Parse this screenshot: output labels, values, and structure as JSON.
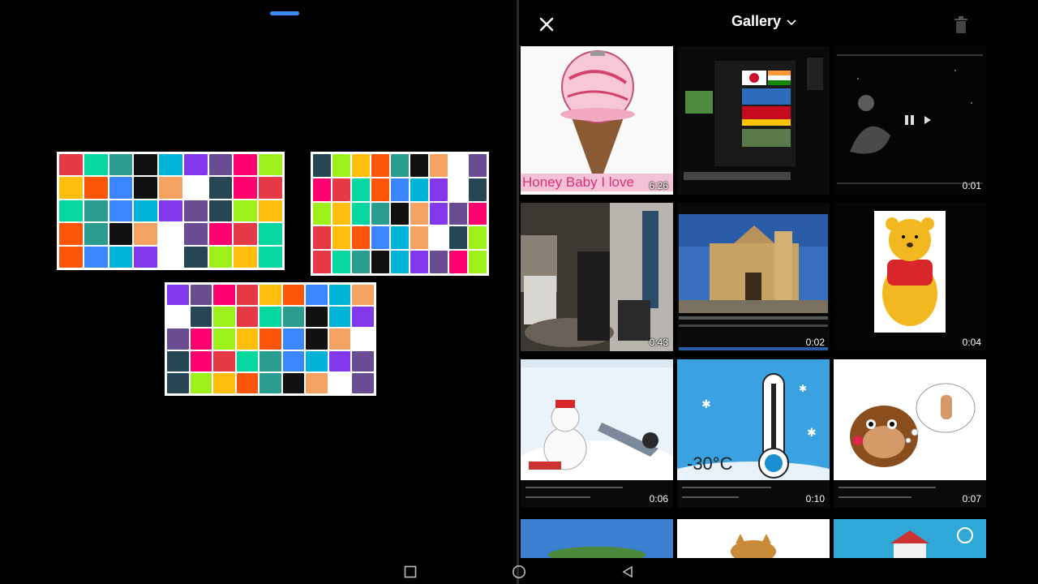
{
  "left_pane": {
    "collages": [
      {
        "name": "collage-preview-1"
      },
      {
        "name": "collage-preview-2"
      },
      {
        "name": "collage-preview-3"
      }
    ]
  },
  "gallery": {
    "title": "Gallery",
    "close_icon": "close-icon",
    "dropdown_icon": "chevron-down-icon",
    "trash_icon": "trash-icon",
    "items": [
      {
        "name": "gallery-item-ice-cream",
        "duration": "6:26",
        "overlay_text": "Honey Baby I love"
      },
      {
        "name": "gallery-item-flags-video",
        "duration": ""
      },
      {
        "name": "gallery-item-fairy-night",
        "duration": "0:01"
      },
      {
        "name": "gallery-item-room",
        "duration": "0:43"
      },
      {
        "name": "gallery-item-church",
        "duration": "0:02"
      },
      {
        "name": "gallery-item-pooh",
        "duration": "0:04"
      },
      {
        "name": "gallery-item-snowman",
        "duration": "0:06"
      },
      {
        "name": "gallery-item-thermometer",
        "duration": "0:10",
        "overlay_text": "-30°C"
      },
      {
        "name": "gallery-item-beaver",
        "duration": "0:07"
      },
      {
        "name": "gallery-item-sky",
        "duration": ""
      },
      {
        "name": "gallery-item-cat",
        "duration": ""
      },
      {
        "name": "gallery-item-doghouse",
        "duration": ""
      }
    ]
  },
  "nav": {
    "recents_icon": "recents-icon",
    "home_icon": "home-icon",
    "back_icon": "back-icon"
  },
  "colors": {
    "accent": "#3b8cf5",
    "background": "#000000"
  }
}
